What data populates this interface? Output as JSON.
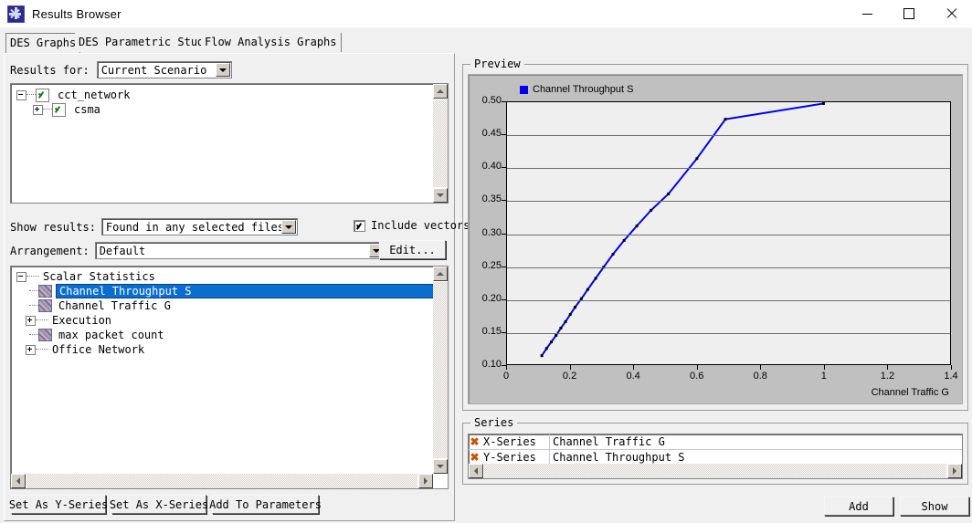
{
  "window": {
    "title": "Results Browser",
    "icon": "app-starburst-icon",
    "minimize": "minimize-icon",
    "maximize": "maximize-icon",
    "close": "close-icon"
  },
  "tabs": [
    {
      "label": "DES Graphs",
      "active": true
    },
    {
      "label": "DES Parametric Studies",
      "active": false
    },
    {
      "label": "Flow Analysis Graphs",
      "active": false
    }
  ],
  "left": {
    "results_for_label": "Results for:",
    "results_for_value": "Current Scenario",
    "file_tree": [
      {
        "label": "cct_network",
        "indent": 0,
        "expander": "minus",
        "checked": true
      },
      {
        "label": "csma",
        "indent": 1,
        "expander": "plus",
        "checked": true
      }
    ],
    "show_results_label": "Show results:",
    "show_results_value": "Found in any selected files",
    "include_vectors_label": "Include vectors",
    "include_vectors_checked": true,
    "arrangement_label": "Arrangement:",
    "arrangement_value": "Default",
    "edit_button": "Edit...",
    "stat_tree": [
      {
        "label": "Scalar Statistics",
        "indent": 0,
        "kind": "folder",
        "expander": "minus",
        "selected": false
      },
      {
        "label": "Channel Throughput S",
        "indent": 1,
        "kind": "stat",
        "expander": "none",
        "selected": true
      },
      {
        "label": "Channel Traffic G",
        "indent": 1,
        "kind": "stat",
        "expander": "none",
        "selected": false
      },
      {
        "label": "Execution",
        "indent": 0,
        "kind": "folder",
        "expander": "plus",
        "selected": false
      },
      {
        "label": "max packet count",
        "indent": 1,
        "kind": "stat",
        "expander": "none",
        "selected": false
      },
      {
        "label": "Office Network",
        "indent": 0,
        "kind": "folder",
        "expander": "plus",
        "selected": false
      }
    ],
    "buttons": [
      {
        "label": "Set As Y-Series",
        "accel": "A"
      },
      {
        "label": "Set As X-Series",
        "accel": "A"
      },
      {
        "label": "Add To Parameters",
        "accel": "A"
      }
    ]
  },
  "right": {
    "preview_group_title": "Preview",
    "series_group_title": "Series",
    "series_rows": [
      {
        "role": "X-Series",
        "name": "Channel Traffic G",
        "remove": "remove-icon"
      },
      {
        "role": "Y-Series",
        "name": "Channel Throughput S",
        "remove": "remove-icon"
      }
    ],
    "add_button": "Add",
    "show_button": "Show"
  },
  "chart_data": {
    "type": "line",
    "title": "",
    "legend": [
      "Channel Throughput S"
    ],
    "legend_position": "top-left",
    "series_color": "#0000ee",
    "xlabel": "Channel Traffic G",
    "ylabel": "",
    "xlim": [
      0,
      1.4
    ],
    "ylim": [
      0.1,
      0.5
    ],
    "xticks": [
      "0",
      "0.2",
      "0.4",
      "0.6",
      "0.8",
      "1",
      "1.2",
      "1.4"
    ],
    "xtickvals": [
      0,
      0.2,
      0.4,
      0.6,
      0.8,
      1.0,
      1.2,
      1.4
    ],
    "yticks": [
      "0.10",
      "0.15",
      "0.20",
      "0.25",
      "0.30",
      "0.35",
      "0.40",
      "0.45",
      "0.50"
    ],
    "ytickvals": [
      0.1,
      0.15,
      0.2,
      0.25,
      0.3,
      0.35,
      0.4,
      0.45,
      0.5
    ],
    "grid": "horizontal",
    "series": [
      {
        "name": "Channel Throughput S",
        "points": [
          [
            0.11,
            0.113
          ],
          [
            0.125,
            0.124
          ],
          [
            0.14,
            0.134
          ],
          [
            0.155,
            0.144
          ],
          [
            0.17,
            0.155
          ],
          [
            0.185,
            0.165
          ],
          [
            0.2,
            0.176
          ],
          [
            0.215,
            0.187
          ],
          [
            0.235,
            0.2
          ],
          [
            0.255,
            0.214
          ],
          [
            0.28,
            0.231
          ],
          [
            0.305,
            0.248
          ],
          [
            0.335,
            0.268
          ],
          [
            0.37,
            0.289
          ],
          [
            0.41,
            0.311
          ],
          [
            0.455,
            0.335
          ],
          [
            0.51,
            0.36
          ],
          [
            0.6,
            0.414
          ],
          [
            0.69,
            0.474
          ],
          [
            1.0,
            0.498
          ]
        ]
      }
    ]
  }
}
